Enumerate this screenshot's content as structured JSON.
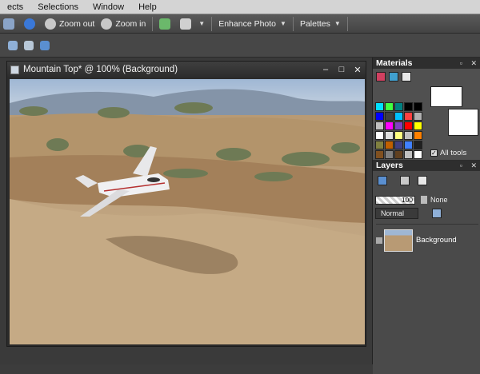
{
  "menubar": {
    "items": [
      "ects",
      "Selections",
      "Window",
      "Help"
    ]
  },
  "toolbar": {
    "zoom_out_label": "Zoom out",
    "zoom_in_label": "Zoom in",
    "enhance_photo_label": "Enhance Photo",
    "palettes_label": "Palettes"
  },
  "document": {
    "title": "Mountain Top* @ 100% (Background)",
    "controls": {
      "minimize": "–",
      "maximize": "□",
      "close": "✕"
    }
  },
  "materials": {
    "title": "Materials",
    "all_tools_label": "All tools",
    "swatches": [
      "#00e0ff",
      "#40ff40",
      "#008080",
      "#000000",
      "#000000",
      "#0000ff",
      "#404040",
      "#00c0ff",
      "#ff4040",
      "#b0b0b0",
      "#c0c0c0",
      "#ff00ff",
      "#8040c0",
      "#ff0000",
      "#ffff00",
      "#ffffff",
      "#e0e0e0",
      "#ffff80",
      "#c0c0c0",
      "#ff8000",
      "#808040",
      "#c06000",
      "#404080",
      "#4080ff",
      "#202020",
      "#805020",
      "#808080",
      "#604020",
      "#c0c0c0",
      "#ffffff"
    ]
  },
  "layers": {
    "title": "Layers",
    "opacity": "100",
    "blend_mode": "Normal",
    "mask_label": "None",
    "layer_name": "Background"
  },
  "colors": {
    "panel_title_bg": "#2e2e2e",
    "workspace_bg": "#3a3a3a"
  }
}
